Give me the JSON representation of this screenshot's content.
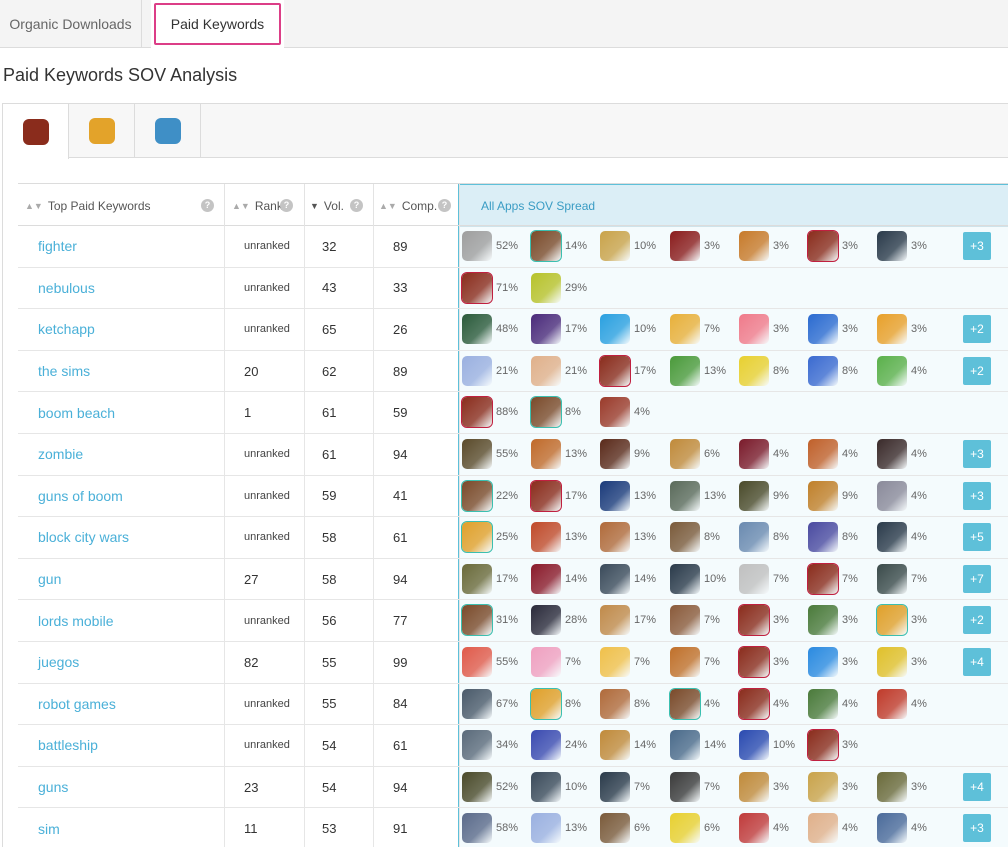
{
  "top_tabs": [
    {
      "label": "Organic Downloads"
    },
    {
      "label": "Paid Keywords"
    }
  ],
  "page_title": "Paid Keywords SOV Analysis",
  "app_tabs": [
    {
      "icon": "warrior-app-icon",
      "color": "#8a2c1c"
    },
    {
      "icon": "barbarian-app-icon",
      "color": "#e3a32a"
    },
    {
      "icon": "clash-royale-app-icon",
      "color": "#3f8fc6"
    }
  ],
  "table": {
    "headers": {
      "keyword": "Top Paid Keywords",
      "rank": "Rank",
      "vol": "Vol.",
      "comp": "Comp.",
      "sov": "All Apps SOV Spread"
    },
    "help_glyph": "?",
    "rows": [
      {
        "keyword": "fighter",
        "rank": "unranked",
        "vol": "32",
        "comp": "89",
        "apps": [
          {
            "c": "#9e9e9e",
            "p": "52%"
          },
          {
            "c": "#7a4a2a",
            "p": "14%",
            "h": "teal"
          },
          {
            "c": "#c9a34a",
            "p": "10%"
          },
          {
            "c": "#8a1c1c",
            "p": "3%"
          },
          {
            "c": "#c77a2a",
            "p": "3%"
          },
          {
            "c": "#8a2c1c",
            "p": "3%",
            "h": "red"
          },
          {
            "c": "#2a3a4a",
            "p": "3%"
          }
        ],
        "more": "+3"
      },
      {
        "keyword": "nebulous",
        "rank": "unranked",
        "vol": "43",
        "comp": "33",
        "apps": [
          {
            "c": "#8a2c1c",
            "p": "71%",
            "h": "red"
          },
          {
            "c": "#b7c22a",
            "p": "29%"
          }
        ],
        "more": ""
      },
      {
        "keyword": "ketchapp",
        "rank": "unranked",
        "vol": "65",
        "comp": "26",
        "apps": [
          {
            "c": "#2a5a3a",
            "p": "48%"
          },
          {
            "c": "#4a2a7a",
            "p": "17%"
          },
          {
            "c": "#2aa0e0",
            "p": "10%"
          },
          {
            "c": "#e8b03a",
            "p": "7%"
          },
          {
            "c": "#f07a8a",
            "p": "3%"
          },
          {
            "c": "#2a6ad0",
            "p": "3%"
          },
          {
            "c": "#e8a02a",
            "p": "3%"
          }
        ],
        "more": "+2"
      },
      {
        "keyword": "the sims",
        "rank": "20",
        "vol": "62",
        "comp": "89",
        "apps": [
          {
            "c": "#9ab0e0",
            "p": "21%"
          },
          {
            "c": "#e0b08a",
            "p": "21%"
          },
          {
            "c": "#8a2c1c",
            "p": "17%",
            "h": "red"
          },
          {
            "c": "#4a9a3a",
            "p": "13%"
          },
          {
            "c": "#e8d030",
            "p": "8%"
          },
          {
            "c": "#3a6ad0",
            "p": "8%"
          },
          {
            "c": "#5ab04a",
            "p": "4%"
          }
        ],
        "more": "+2"
      },
      {
        "keyword": "boom beach",
        "rank": "1",
        "vol": "61",
        "comp": "59",
        "apps": [
          {
            "c": "#8a2c1c",
            "p": "88%",
            "h": "red"
          },
          {
            "c": "#7a4a2a",
            "p": "8%",
            "h": "teal"
          },
          {
            "c": "#9a3a2a",
            "p": "4%"
          }
        ],
        "more": ""
      },
      {
        "keyword": "zombie",
        "rank": "unranked",
        "vol": "61",
        "comp": "94",
        "apps": [
          {
            "c": "#5a4a2a",
            "p": "55%"
          },
          {
            "c": "#c06a2a",
            "p": "13%"
          },
          {
            "c": "#5a2a1a",
            "p": "9%"
          },
          {
            "c": "#c08a3a",
            "p": "6%"
          },
          {
            "c": "#7a1a2a",
            "p": "4%"
          },
          {
            "c": "#c0602a",
            "p": "4%"
          },
          {
            "c": "#3a2a2a",
            "p": "4%"
          }
        ],
        "more": "+3"
      },
      {
        "keyword": "guns of boom",
        "rank": "unranked",
        "vol": "59",
        "comp": "41",
        "apps": [
          {
            "c": "#7a4a2a",
            "p": "22%",
            "h": "teal"
          },
          {
            "c": "#8a2c1c",
            "p": "17%",
            "h": "red"
          },
          {
            "c": "#1a3a7a",
            "p": "13%"
          },
          {
            "c": "#5a6a5a",
            "p": "13%"
          },
          {
            "c": "#4a4a2a",
            "p": "9%"
          },
          {
            "c": "#c0802a",
            "p": "9%"
          },
          {
            "c": "#8a8a9a",
            "p": "4%"
          }
        ],
        "more": "+3"
      },
      {
        "keyword": "block city wars",
        "rank": "unranked",
        "vol": "58",
        "comp": "61",
        "apps": [
          {
            "c": "#e0a02a",
            "p": "25%",
            "h": "teal"
          },
          {
            "c": "#c04a2a",
            "p": "13%"
          },
          {
            "c": "#b06a3a",
            "p": "13%"
          },
          {
            "c": "#7a5a3a",
            "p": "8%"
          },
          {
            "c": "#6a8ab0",
            "p": "8%"
          },
          {
            "c": "#4a4aa0",
            "p": "8%"
          },
          {
            "c": "#2a3a4a",
            "p": "4%"
          }
        ],
        "more": "+5"
      },
      {
        "keyword": "gun",
        "rank": "27",
        "vol": "58",
        "comp": "94",
        "apps": [
          {
            "c": "#6a6a3a",
            "p": "17%"
          },
          {
            "c": "#8a1a2a",
            "p": "14%"
          },
          {
            "c": "#3a4a5a",
            "p": "14%"
          },
          {
            "c": "#2a3a4a",
            "p": "10%"
          },
          {
            "c": "#c0c0c0",
            "p": "7%"
          },
          {
            "c": "#8a2c1c",
            "p": "7%",
            "h": "red"
          },
          {
            "c": "#3a4a4a",
            "p": "7%"
          }
        ],
        "more": "+7"
      },
      {
        "keyword": "lords mobile",
        "rank": "unranked",
        "vol": "56",
        "comp": "77",
        "apps": [
          {
            "c": "#7a4a2a",
            "p": "31%",
            "h": "teal"
          },
          {
            "c": "#2a2a3a",
            "p": "28%"
          },
          {
            "c": "#c08a4a",
            "p": "17%"
          },
          {
            "c": "#8a5a3a",
            "p": "7%"
          },
          {
            "c": "#8a2c1c",
            "p": "3%",
            "h": "red"
          },
          {
            "c": "#4a7a3a",
            "p": "3%"
          },
          {
            "c": "#e0a02a",
            "p": "3%",
            "h": "teal"
          }
        ],
        "more": "+2"
      },
      {
        "keyword": "juegos",
        "rank": "82",
        "vol": "55",
        "comp": "99",
        "apps": [
          {
            "c": "#e05a4a",
            "p": "55%"
          },
          {
            "c": "#f0a0c0",
            "p": "7%"
          },
          {
            "c": "#f0c04a",
            "p": "7%"
          },
          {
            "c": "#c0702a",
            "p": "7%"
          },
          {
            "c": "#8a2c1c",
            "p": "3%",
            "h": "red"
          },
          {
            "c": "#2a8ae0",
            "p": "3%"
          },
          {
            "c": "#e0c02a",
            "p": "3%"
          }
        ],
        "more": "+4"
      },
      {
        "keyword": "robot games",
        "rank": "unranked",
        "vol": "55",
        "comp": "84",
        "apps": [
          {
            "c": "#4a5a6a",
            "p": "67%"
          },
          {
            "c": "#e0a02a",
            "p": "8%",
            "h": "teal"
          },
          {
            "c": "#b06a3a",
            "p": "8%"
          },
          {
            "c": "#7a4a2a",
            "p": "4%",
            "h": "teal"
          },
          {
            "c": "#8a2c1c",
            "p": "4%",
            "h": "red"
          },
          {
            "c": "#4a7a3a",
            "p": "4%"
          },
          {
            "c": "#c03a2a",
            "p": "4%"
          }
        ],
        "more": ""
      },
      {
        "keyword": "battleship",
        "rank": "unranked",
        "vol": "54",
        "comp": "61",
        "apps": [
          {
            "c": "#5a6a7a",
            "p": "34%"
          },
          {
            "c": "#3a4ab0",
            "p": "24%"
          },
          {
            "c": "#c08a3a",
            "p": "14%"
          },
          {
            "c": "#4a6a8a",
            "p": "14%"
          },
          {
            "c": "#2a4ab0",
            "p": "10%"
          },
          {
            "c": "#8a2c1c",
            "p": "3%",
            "h": "red"
          }
        ],
        "more": ""
      },
      {
        "keyword": "guns",
        "rank": "23",
        "vol": "54",
        "comp": "94",
        "apps": [
          {
            "c": "#4a4a2a",
            "p": "52%"
          },
          {
            "c": "#3a4a5a",
            "p": "10%"
          },
          {
            "c": "#2a3a4a",
            "p": "7%"
          },
          {
            "c": "#3a3a3a",
            "p": "7%"
          },
          {
            "c": "#c08a3a",
            "p": "3%"
          },
          {
            "c": "#c9a34a",
            "p": "3%"
          },
          {
            "c": "#6a6a3a",
            "p": "3%"
          }
        ],
        "more": "+4"
      },
      {
        "keyword": "sim",
        "rank": "11",
        "vol": "53",
        "comp": "91",
        "apps": [
          {
            "c": "#5a6a8a",
            "p": "58%"
          },
          {
            "c": "#9ab0e0",
            "p": "13%"
          },
          {
            "c": "#7a5a3a",
            "p": "6%"
          },
          {
            "c": "#e8d030",
            "p": "6%"
          },
          {
            "c": "#c03a3a",
            "p": "4%"
          },
          {
            "c": "#e0b08a",
            "p": "4%"
          },
          {
            "c": "#4a6a9a",
            "p": "4%"
          }
        ],
        "more": "+3"
      }
    ]
  }
}
